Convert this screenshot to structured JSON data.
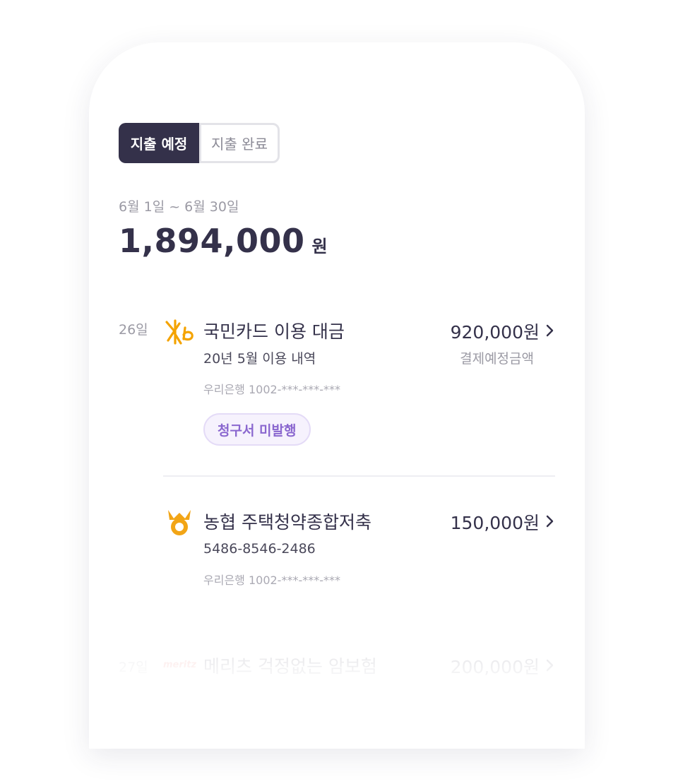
{
  "tabs": {
    "active": "지출 예정",
    "inactive": "지출 완료"
  },
  "summary": {
    "period": "6월 1일 ~ 6월 30일",
    "total": "1,894,000",
    "unit": "원"
  },
  "items": [
    {
      "date": "26일",
      "title": "국민카드 이용 대금",
      "subtitle": "20년 5월 이용 내역",
      "account": "우리은행 1002-***-***-***",
      "amount": "920,000원",
      "amount_note": "결제예정금액",
      "badge": "청구서 미발행",
      "logo": "kb-card-logo"
    },
    {
      "date": "",
      "title": "농협 주택청약종합저축",
      "subtitle": "5486-8546-2486",
      "account": "우리은행 1002-***-***-***",
      "amount": "150,000원",
      "logo": "nh-bank-logo"
    },
    {
      "date": "27일",
      "title": "메리츠 걱정없는 암보험",
      "amount": "200,000원",
      "logo": "meritz-logo",
      "logo_text": "meritz"
    }
  ],
  "colors": {
    "primary": "#34314a",
    "badge_text": "#8a67cf",
    "kb_orange": "#f4a300",
    "nh_orange": "#f2a516",
    "meritz_red": "#e8534a"
  }
}
